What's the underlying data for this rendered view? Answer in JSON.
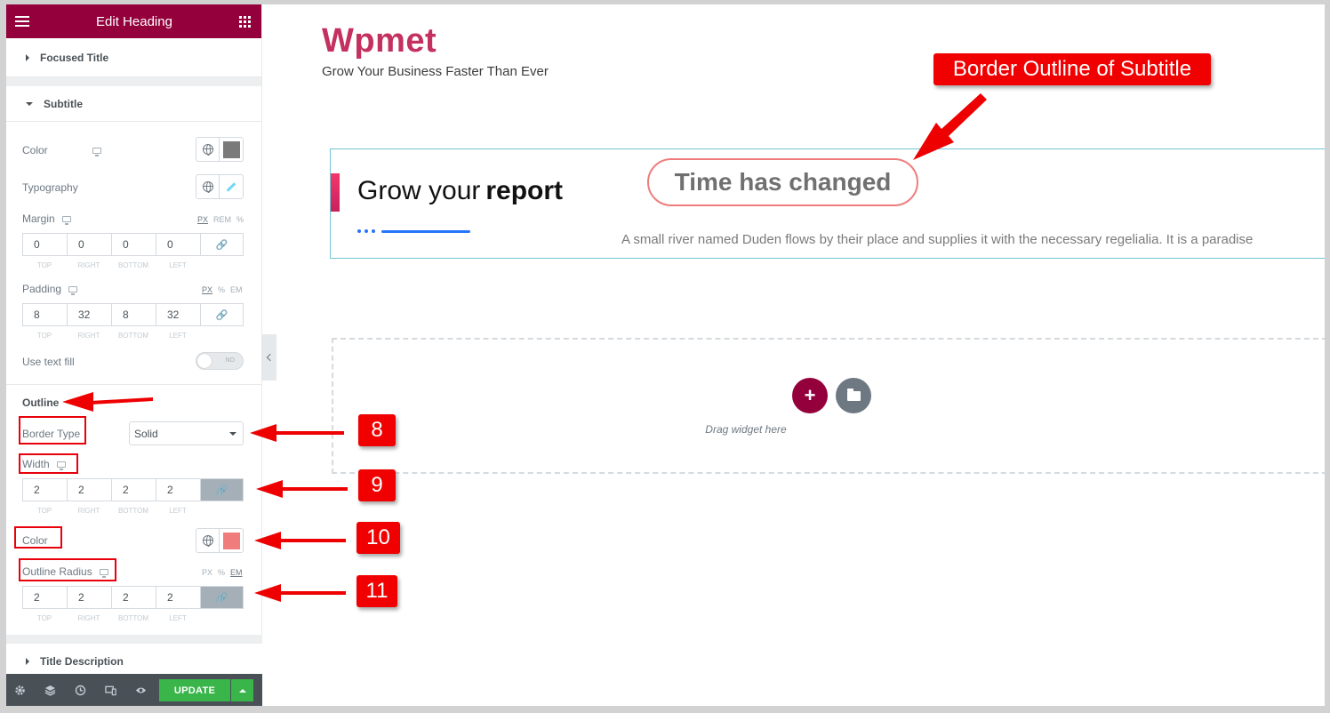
{
  "sidebar": {
    "title": "Edit Heading",
    "sections": {
      "focused_title": "Focused Title",
      "subtitle": "Subtitle",
      "title_description": "Title Description"
    },
    "color_label": "Color",
    "typography_label": "Typography",
    "margin": {
      "label": "Margin",
      "units": [
        "PX",
        "REM",
        "%"
      ],
      "values": [
        "0",
        "0",
        "0",
        "0"
      ]
    },
    "padding": {
      "label": "Padding",
      "units": [
        "PX",
        "%",
        "EM"
      ],
      "values": [
        "8",
        "32",
        "8",
        "32"
      ]
    },
    "dim_labels": [
      "TOP",
      "RIGHT",
      "BOTTOM",
      "LEFT"
    ],
    "text_fill": {
      "label": "Use text fill",
      "state": "NO"
    },
    "outline": {
      "heading": "Outline",
      "border_type_label": "Border Type",
      "border_type_value": "Solid",
      "width_label": "Width",
      "width_values": [
        "2",
        "2",
        "2",
        "2"
      ],
      "color_label": "Color",
      "radius_label": "Outline Radius",
      "radius_units": [
        "PX",
        "%",
        "EM"
      ],
      "radius_values": [
        "2",
        "2",
        "2",
        "2"
      ]
    },
    "footer": {
      "update_label": "UPDATE"
    }
  },
  "canvas": {
    "brand": "Wpmet",
    "tagline": "Grow Your Business Faster Than Ever",
    "heading_light": "Grow your",
    "heading_bold": "report",
    "subtitle": "Time has changed",
    "description": "A small river named Duden flows by their place and supplies it with the necessary regelialia. It is a paradise",
    "drag_hint": "Drag widget here"
  },
  "annotations": {
    "callout": "Border Outline of Subtitle",
    "steps": [
      "8",
      "9",
      "10",
      "11"
    ]
  },
  "colors": {
    "brand_primary": "#93003c",
    "subtitle_color": "#7a7a7a",
    "outline_color": "#f17c7c",
    "update_green": "#39b54a",
    "annotation_red": "#f00000"
  }
}
